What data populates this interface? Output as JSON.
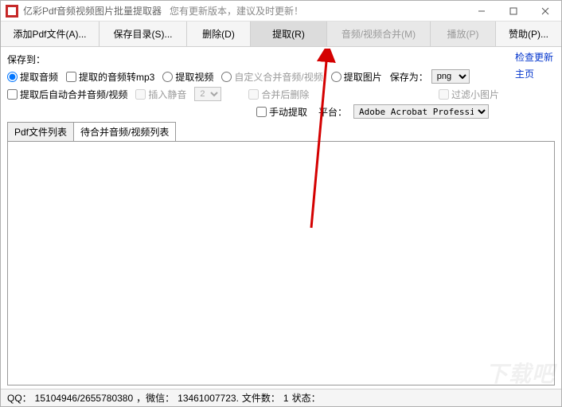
{
  "title": "亿彩Pdf音频视频图片批量提取器",
  "title_sub": "您有更新版本，建议及时更新！",
  "toolbar": {
    "add": "添加Pdf文件(A)...",
    "savedir": "保存目录(S)...",
    "delete": "删除(D)",
    "extract": "提取(R)",
    "merge": "音频/视频合并(M)",
    "play": "播放(P)",
    "donate": "赞助(P)..."
  },
  "opts": {
    "save_to_label": "保存到：",
    "radio_audio": "提取音频",
    "cb_mp3": "提取的音频转mp3",
    "radio_video": "提取视频",
    "radio_custom": "自定义合并音频/视频",
    "radio_image": "提取图片",
    "save_as_label": "保存为：",
    "save_as_value": "png",
    "cb_automerge": "提取后自动合并音频/视频",
    "cb_silence": "插入静音",
    "silence_value": "2",
    "cb_merge_delete": "合并后删除",
    "cb_filter_small": "过滤小图片",
    "cb_manual": "手动提取",
    "platform_label": "平台：",
    "platform_value": "Adobe Acrobat Profession"
  },
  "links": {
    "check_update": "检查更新",
    "homepage": "主页"
  },
  "tabs": {
    "filelist": "Pdf文件列表",
    "mergelist": "待合并音频/视频列表"
  },
  "status": {
    "qq_label": "QQ：",
    "qq_value": "15104946/2655780380",
    "wechat_label": "，微信：",
    "wechat_value": "13461007723.",
    "files_label": " 文件数：",
    "files_value": "1",
    "state_label": " 状态：",
    "state_value": ""
  },
  "watermark": "下载吧"
}
